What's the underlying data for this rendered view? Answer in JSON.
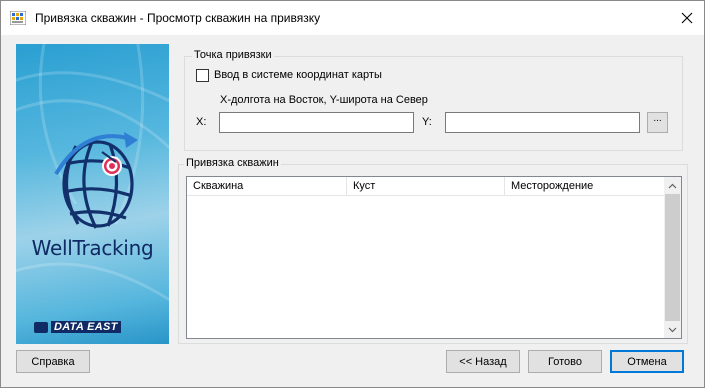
{
  "window": {
    "title": "Привязка скважин - Просмотр скважин на привязку",
    "close_glyph": "✕"
  },
  "banner": {
    "brand": "WellTracking",
    "vendor": "DATA EAST"
  },
  "anchor_group": {
    "label": "Точка привязки",
    "checkbox_label": "Ввод в системе координат карты",
    "checkbox_checked": false,
    "hint": "X-долгота на Восток, Y-широта на Север",
    "x_label": "X:",
    "x_value": "",
    "y_label": "Y:",
    "y_value": "",
    "browse_label": "..."
  },
  "wells_group": {
    "label": "Привязка скважин",
    "columns": [
      "Скважина",
      "Куст",
      "Месторождение"
    ],
    "rows": []
  },
  "buttons": {
    "help": "Справка",
    "back": "<< Назад",
    "done": "Готово",
    "cancel": "Отмена"
  },
  "colors": {
    "banner_blue": "#2a9fd2",
    "brand_navy": "#0f2a64",
    "accent_red": "#e0305a",
    "focus_blue": "#0078d7"
  }
}
